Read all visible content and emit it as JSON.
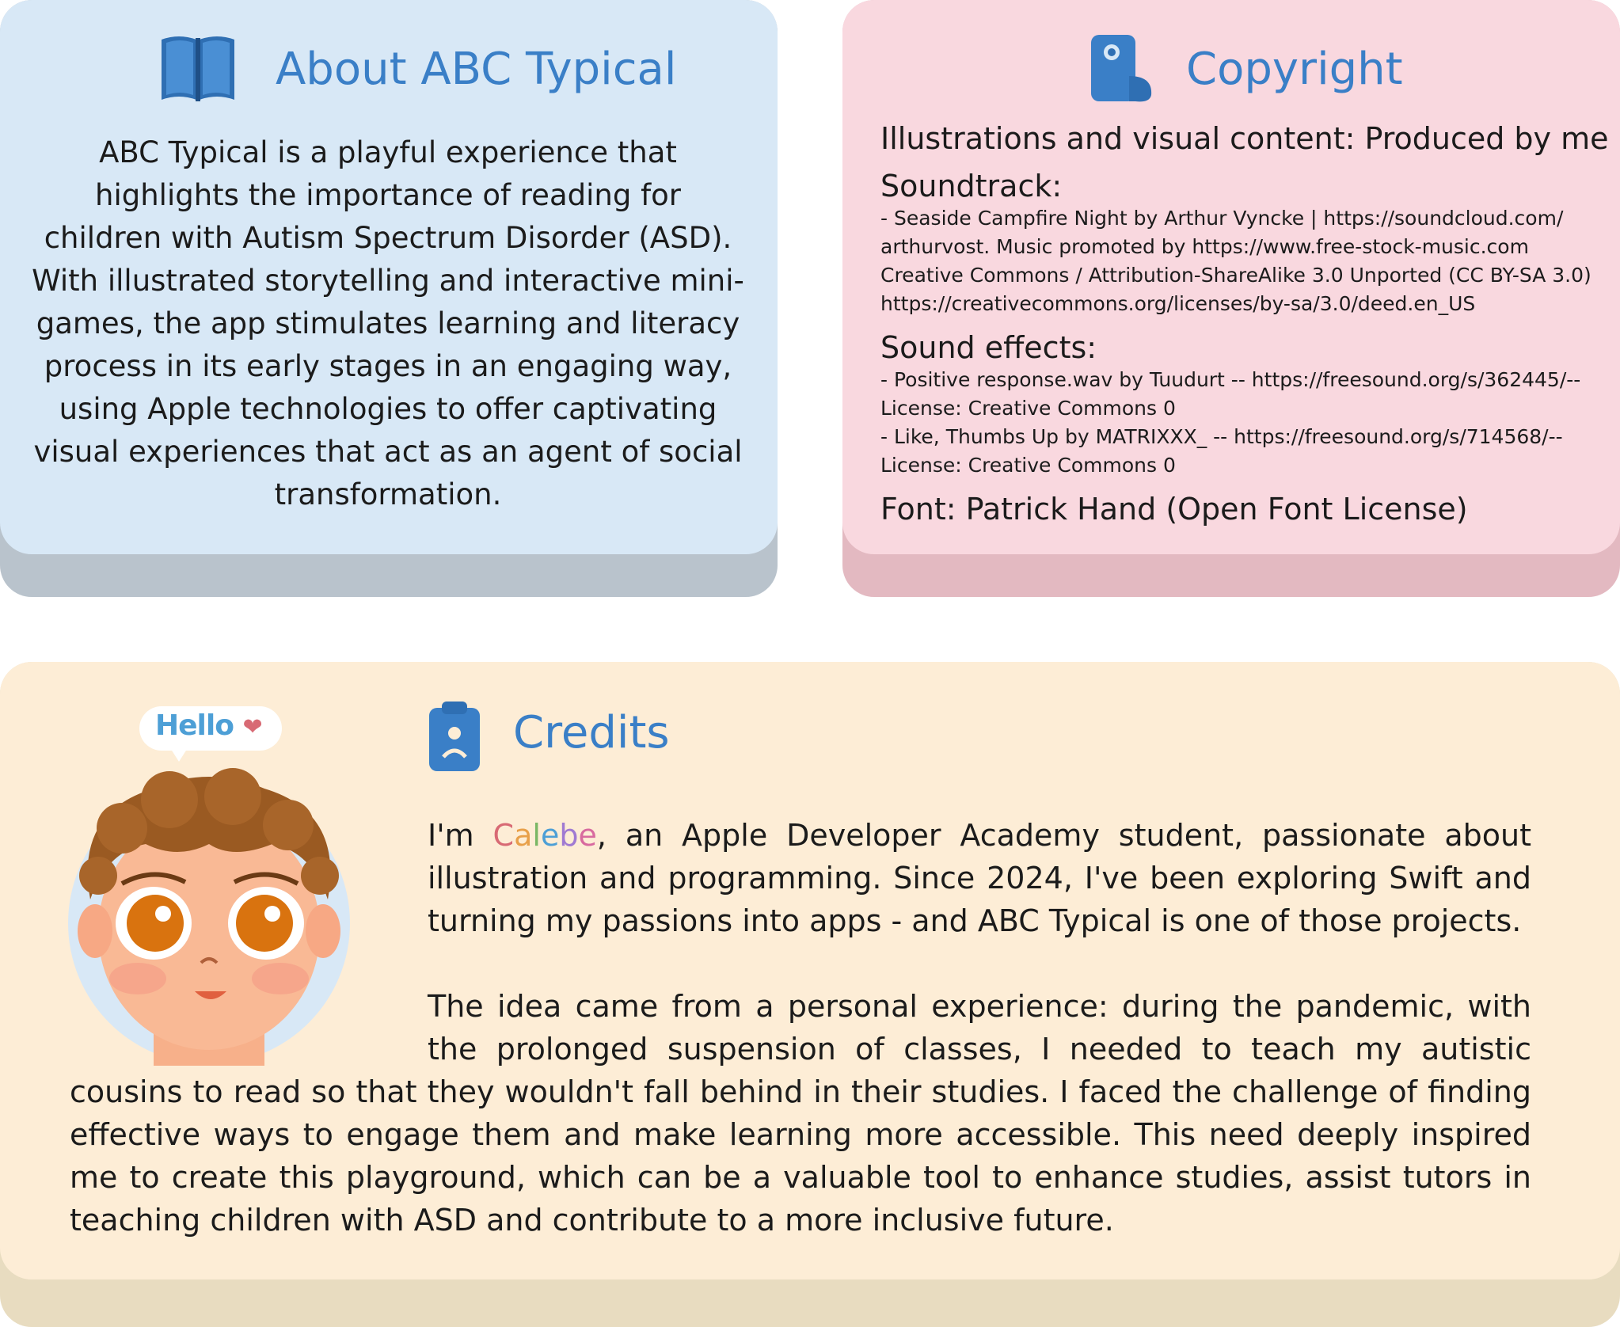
{
  "about": {
    "title": "About ABC Typical",
    "icon": "book-icon",
    "body": "ABC Typical is a playful experience that highlights the importance of reading for children with Autism Spectrum Disorder (ASD). With illustrated storytelling and interactive mini-games, the app stimulates learning and literacy process in its early stages in an engaging way, using Apple technologies to offer captivating visual experiences that act as an agent of social transformation."
  },
  "copyright": {
    "title": "Copyright",
    "icon": "scroll-icon",
    "illustrations": "Illustrations and visual content: Produced by me",
    "soundtrack_heading": "Soundtrack:",
    "soundtrack_lines": [
      "- Seaside Campfire Night by Arthur Vyncke | https://soundcloud.com/",
      "arthurvost. Music promoted by https://www.free-stock-music.com",
      "Creative Commons / Attribution-ShareAlike 3.0 Unported (CC BY-SA 3.0)",
      "https://creativecommons.org/licenses/by-sa/3.0/deed.en_US"
    ],
    "effects_heading": "Sound effects:",
    "effects_lines": [
      "- Positive response.wav by Tuudurt -- https://freesound.org/s/362445/--",
      "License: Creative Commons 0",
      "- Like, Thumbs Up by MATRIXXX_ -- https://freesound.org/s/714568/--",
      "License: Creative Commons 0"
    ],
    "font": "Font: Patrick Hand (Open Font License)"
  },
  "credits": {
    "title": "Credits",
    "icon": "clipboard-icon",
    "speech": "Hello",
    "para1_prefix": "I'm ",
    "name_letters": [
      "C",
      "a",
      "l",
      "e",
      "b",
      "e"
    ],
    "para1_rest": ", an Apple Developer Academy student, passionate about illustration and programming. Since 2024, I've been exploring Swift and turning my passions into apps - and ABC Typical is one of those projects.",
    "para2": "The idea came from a personal experience: during the pandemic, with the prolonged suspension of classes, I needed to teach my autistic cousins to read so that they wouldn't fall behind in their studies. I faced the challenge of finding effective ways to engage them and make learning more accessible. This need deeply inspired me to create this playground, which can be a valuable tool to enhance studies, assist tutors in teaching children with ASD and contribute to a more inclusive future."
  },
  "colors": {
    "accent": "#3a7fc7",
    "about_bg": "#d8e8f6",
    "copyright_bg": "#f9d8df",
    "credits_bg": "#fdedd6"
  }
}
